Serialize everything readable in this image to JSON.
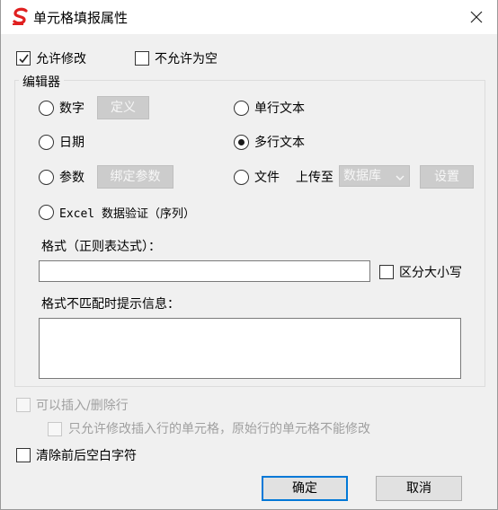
{
  "window": {
    "title": "单元格填报属性"
  },
  "options": {
    "allow_edit_label": "允许修改",
    "allow_edit_checked": true,
    "not_empty_label": "不允许为空",
    "not_empty_checked": false
  },
  "editor": {
    "group_label": "编辑器",
    "number_label": "数字",
    "define_button": "定义",
    "single_line_label": "单行文本",
    "date_label": "日期",
    "multi_line_label": "多行文本",
    "selected": "multi_line",
    "param_label": "参数",
    "bind_param_button": "绑定参数",
    "file_label": "文件",
    "upload_to_label": "上传至",
    "upload_target": "数据库",
    "settings_button": "设置",
    "excel_label": "Excel 数据验证（序列）",
    "format_label": "格式（正则表达式）：",
    "format_value": "",
    "case_sensitive_label": "区分大小写",
    "mismatch_label": "格式不匹配时提示信息：",
    "mismatch_value": ""
  },
  "insert_delete": {
    "label": "可以插入/删除行",
    "only_inserted_label": "只允许修改插入行的单元格，原始行的单元格不能修改"
  },
  "trim": {
    "label": "清除前后空白字符"
  },
  "footer": {
    "ok_label": "确定",
    "cancel_label": "取消"
  },
  "colors": {
    "accent": "#0078d7",
    "logo_red": "#e02020",
    "disabled_bg": "#cccccc"
  },
  "icons": {
    "app": "s-logo-icon",
    "close": "close-icon",
    "dropdown": "chevron-down-icon"
  }
}
